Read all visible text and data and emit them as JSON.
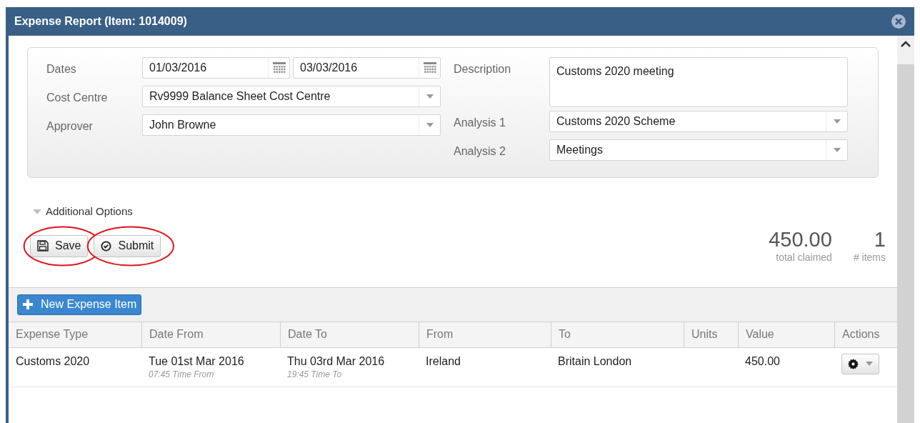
{
  "window": {
    "title": "Expense Report (Item: 1014009)"
  },
  "form": {
    "left": [
      {
        "kind": "daterange",
        "label": "Dates",
        "values": [
          "01/03/2016",
          "03/03/2016"
        ]
      },
      {
        "kind": "select",
        "label": "Cost Centre",
        "value": "Rv9999 Balance Sheet Cost Centre"
      },
      {
        "kind": "select",
        "label": "Approver",
        "value": "John Browne"
      }
    ],
    "right": [
      {
        "kind": "textarea",
        "label": "Description",
        "value": "Customs 2020 meeting"
      },
      {
        "kind": "select",
        "label": "Analysis 1",
        "value": "Customs 2020 Scheme"
      },
      {
        "kind": "select",
        "label": "Analysis 2",
        "value": "Meetings"
      }
    ]
  },
  "additional_options": {
    "label": "Additional Options"
  },
  "buttons": [
    {
      "kind": "save",
      "label": "Save",
      "circled": true
    },
    {
      "kind": "submit",
      "label": "Submit",
      "circled": true
    }
  ],
  "totals": [
    {
      "value": "450.00",
      "label": "total claimed"
    },
    {
      "value": "1",
      "label": "# items"
    }
  ],
  "table": {
    "new_button": "New Expense Item",
    "columns": [
      "Expense Type",
      "Date From",
      "Date To",
      "From",
      "To",
      "Units",
      "Value",
      "Actions"
    ],
    "rows": [
      {
        "cells": [
          {
            "kind": "text",
            "text": "Customs 2020"
          },
          {
            "kind": "text",
            "text": "Tue 01st Mar 2016",
            "note": "07:45 Time From"
          },
          {
            "kind": "text",
            "text": "Thu 03rd Mar 2016",
            "note": "19:45 Time To"
          },
          {
            "kind": "text",
            "text": "Ireland"
          },
          {
            "kind": "text",
            "text": "Britain London"
          },
          {
            "kind": "empty"
          },
          {
            "kind": "text",
            "text": "450.00"
          },
          {
            "kind": "actions"
          }
        ]
      }
    ]
  }
}
